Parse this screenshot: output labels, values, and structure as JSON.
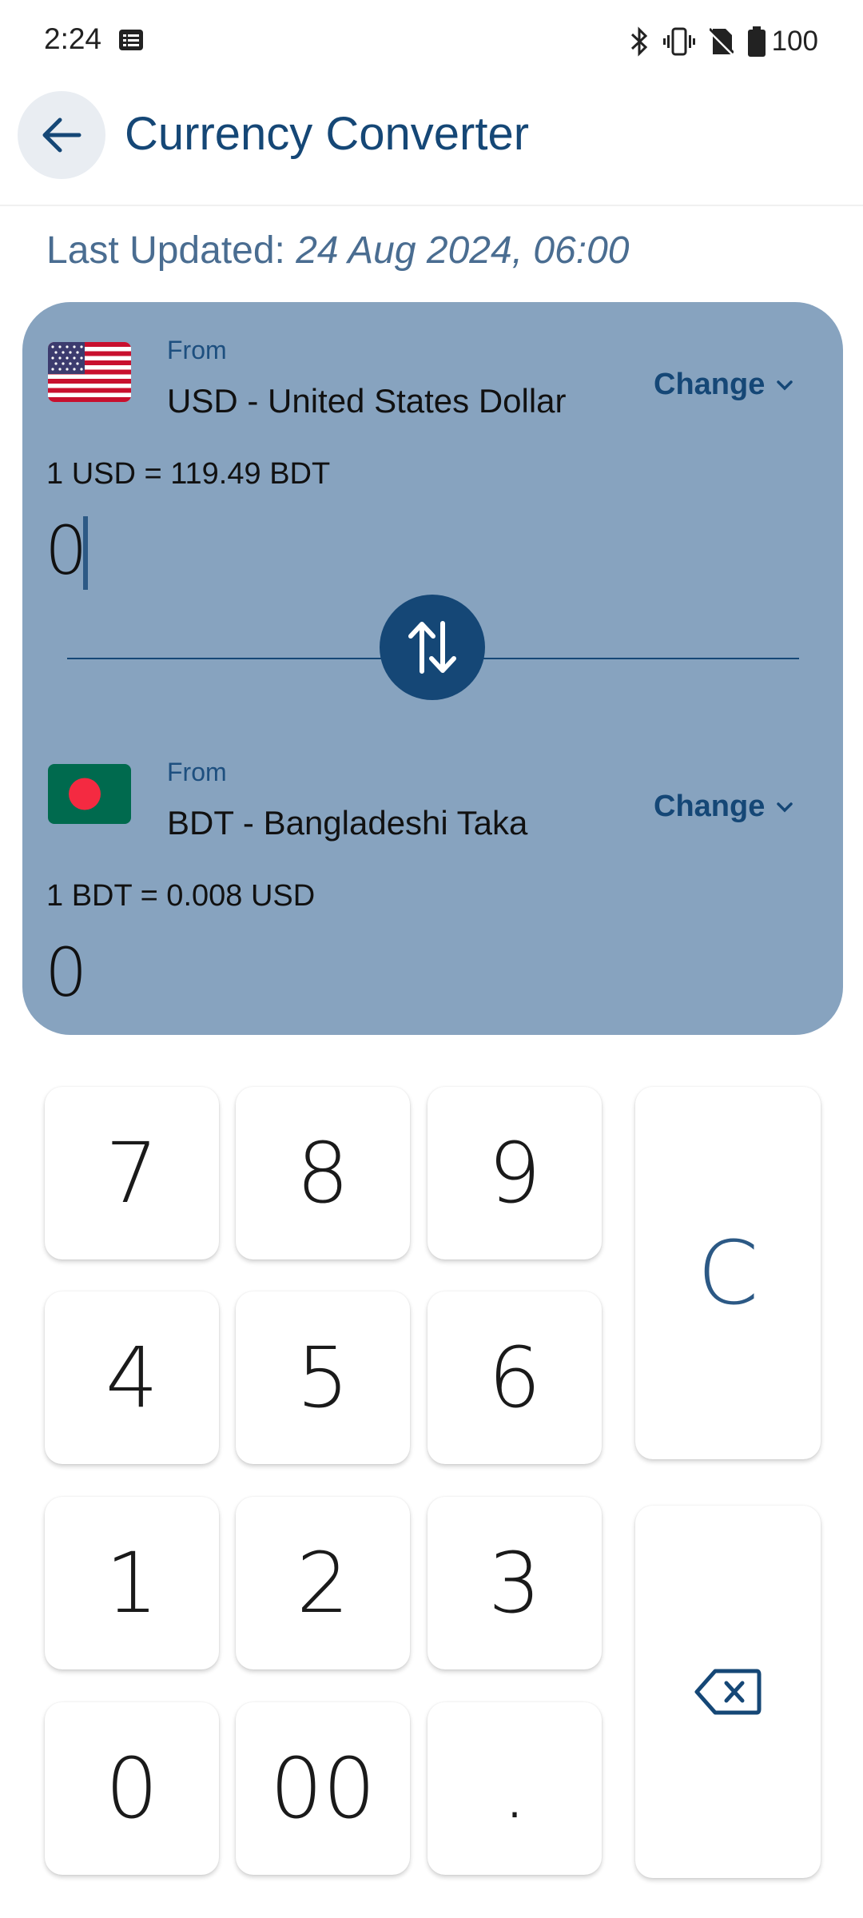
{
  "status_bar": {
    "time": "2:24",
    "battery": "100",
    "icons": [
      "notification-icon",
      "bluetooth-icon",
      "vibrate-icon",
      "no-sim-icon",
      "battery-icon"
    ]
  },
  "app_bar": {
    "title": "Currency Converter",
    "back_icon": "arrow-back-icon"
  },
  "last_updated": {
    "label": "Last Updated: ",
    "timestamp": "24 Aug 2024, 06:00"
  },
  "converter": {
    "from": {
      "label": "From",
      "currency": "USD - United States Dollar",
      "change_label": "Change",
      "rate": "1 USD = 119.49 BDT",
      "amount": "0",
      "flag_icon": "us-flag-icon"
    },
    "to": {
      "label": "From",
      "currency": "BDT - Bangladeshi Taka",
      "change_label": "Change",
      "rate": "1 BDT = 0.008 USD",
      "amount": "0",
      "flag_icon": "bd-flag-icon"
    },
    "swap_icon": "swap-vertical-icon"
  },
  "keypad": {
    "digits": [
      "7",
      "8",
      "9",
      "4",
      "5",
      "6",
      "1",
      "2",
      "3",
      "0",
      "00",
      "."
    ],
    "clear": "C",
    "backspace_icon": "backspace-icon"
  },
  "colors": {
    "primary": "#154776",
    "card": "#87a3bf",
    "accent_text": "#4a6d91"
  }
}
